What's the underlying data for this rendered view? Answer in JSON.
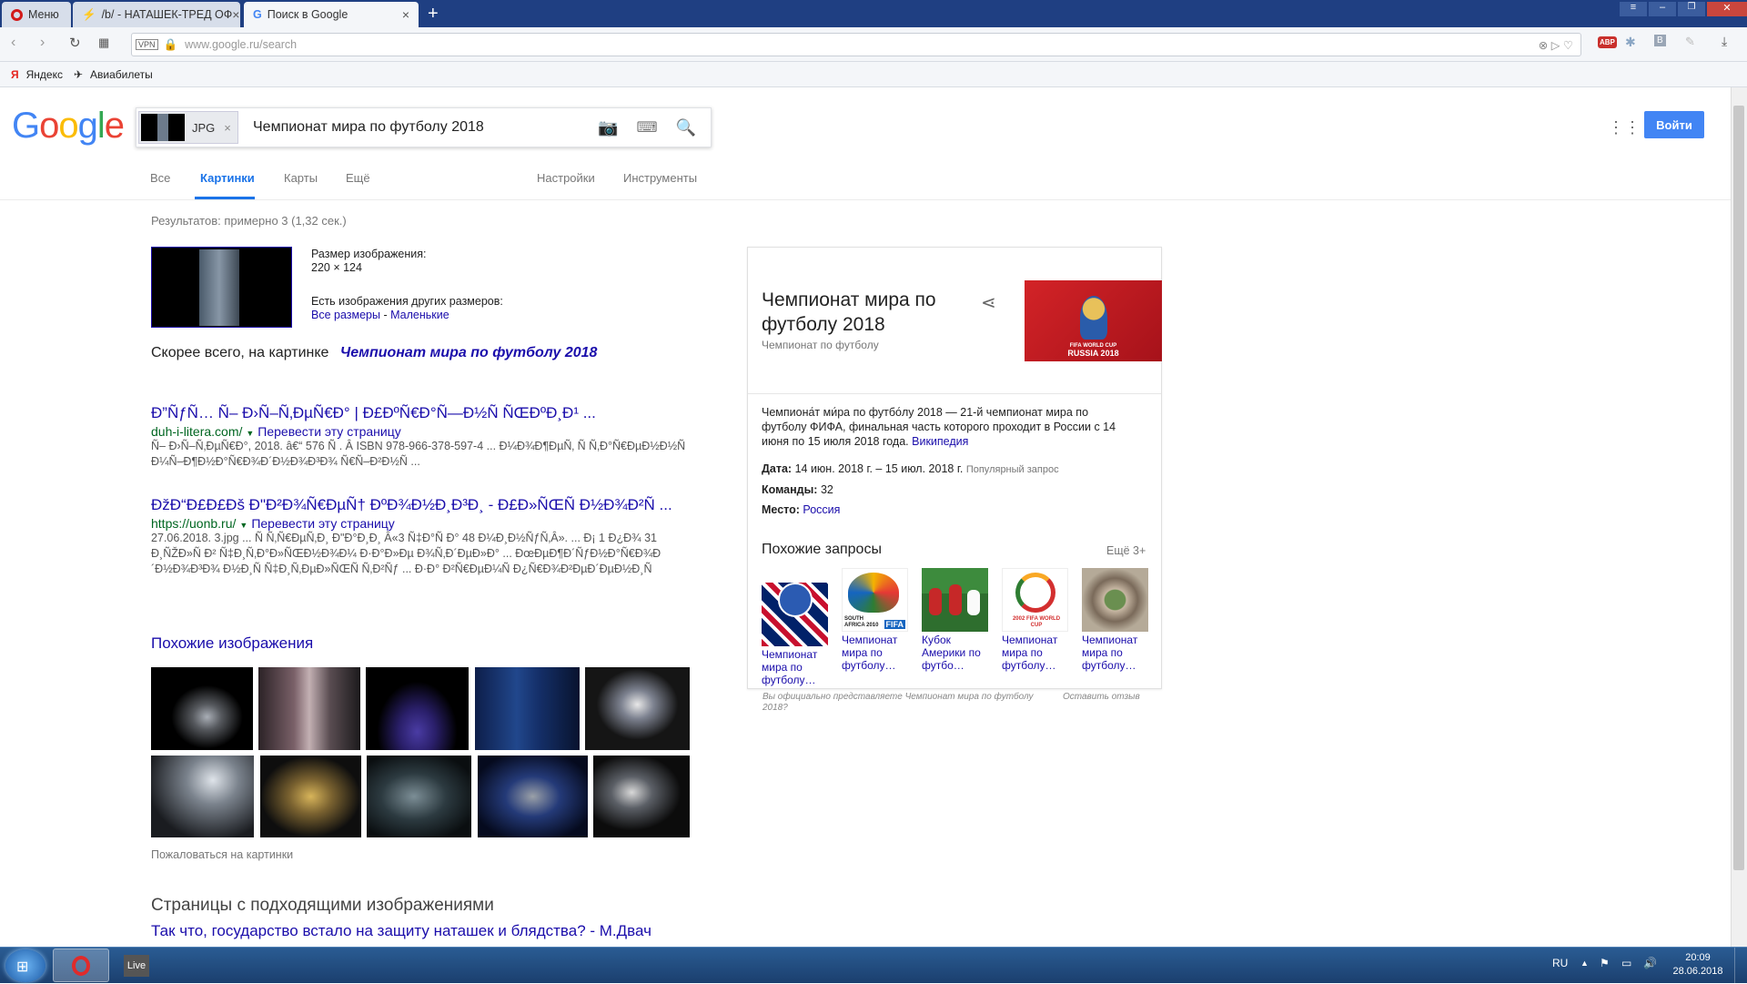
{
  "browser": {
    "tabs": [
      {
        "label": "Меню"
      },
      {
        "label": "/b/ - НАТАШЕК-ТРЕД ОФ"
      },
      {
        "label": "Поиск в Google"
      }
    ],
    "new_tab": "+",
    "address": {
      "host": "www.google.ru",
      "path": "/search"
    },
    "vpn": "VPN",
    "bookmarks": [
      {
        "label": "Яндекс"
      },
      {
        "label": "Авиабилеты"
      }
    ],
    "adblock_badge": "ABP"
  },
  "google": {
    "logo": "Google",
    "image_chip": "JPG",
    "query": "Чемпионат мира по футболу 2018",
    "signin": "Войти",
    "tabs": [
      {
        "label": "Все",
        "active": false
      },
      {
        "label": "Картинки",
        "active": true
      },
      {
        "label": "Карты",
        "active": false
      },
      {
        "label": "Ещё",
        "active": false
      }
    ],
    "tools": [
      {
        "label": "Настройки"
      },
      {
        "label": "Инструменты"
      }
    ]
  },
  "results": {
    "stats": "Результатов: примерно 3 (1,32 сек.)",
    "image_size_label": "Размер изображения:",
    "image_size": "220 × 124",
    "other_sizes_label": "Есть изображения других размеров:",
    "all_sizes": "Все размеры",
    "size_sep": " - ",
    "small": "Маленькие",
    "best_guess_prefix": "Скорее всего, на картинке",
    "best_guess": "Чемпионат мира по футболу 2018",
    "items": [
      {
        "title": "Ð”ÑƒÑ… Ñ– Ð›Ñ–Ñ‚ÐµÑ€Ð° | Ð£ÐºÑ€Ð°Ñ—Ð½Ñ ÑŒÐºÐ¸Ð¹ ...",
        "url": "duh-i-litera.com/",
        "translate": "Перевести эту страницу",
        "snippet": "Ñ– Ð›Ñ–Ñ‚ÐµÑ€Ð°, 2018. â€“ 576 Ñ . Â ISBN 978-966-378-597-4 ... Ð¼Ð¾Ð¶ÐµÑ‚ Ñ Ñ‚Ð°Ñ€ÐµÐ½Ð½Ñ Ð¼Ñ–Ð¶Ð½Ð°Ñ€Ð¾Ð´Ð½Ð¾Ð³Ð¾ Ñ€Ñ–Ð²Ð½Ñ ..."
      },
      {
        "title": "ÐžÐ“Ð£Ð£Ðš Ð\"Ð²Ð¾Ñ€ÐµÑ† ÐºÐ¾Ð½Ð¸Ð³Ð¸ - Ð£Ð»ÑŒÑ Ð½Ð¾Ð²Ñ ...",
        "url": "https://uonb.ru/",
        "translate": "Перевести эту страницу",
        "snippet": "27.06.2018. 3.jpg ... Ñ Ñ‚Ñ€ÐµÑ‚Ð¸ Ð\"Ð°Ð¸Ð¸ Â«3 Ñ‡Ð°Ñ Ð° 48 Ð¼Ð¸Ð½ÑƒÑ‚Â». ... Ð¡ 1 Ð¿Ð¾ 31 Ð¸ÑŽÐ»Ñ Ð² Ñ‡Ð¸Ñ‚Ð°Ð»ÑŒÐ½Ð¾Ð¼ Ð·Ð°Ð»Ðµ Ð¾Ñ‚Ð´ÐµÐ»Ð° ... ÐœÐµÐ¶Ð´ÑƒÐ½Ð°Ñ€Ð¾Ð´Ð½Ð¾Ð³Ð¾ Ð½Ð¸Ñ Ñ‡Ð¸Ñ‚ÐµÐ»ÑŒÑ Ñ‚Ð²Ñƒ ... Ð·Ð° Ð²Ñ€ÐµÐ¼Ñ Ð¿Ñ€Ð¾Ð²ÐµÐ´ÐµÐ½Ð¸Ñ Ñ‡ÐµÐ¼Ð¿Ð¸Ð¾Ð½Ð°Ñ‚Ð° ..."
      }
    ],
    "similar_title": "Похожие изображения",
    "report": "Пожаловаться на картинки",
    "pages_title": "Страницы с подходящими изображениями",
    "pages_first": "Так что, государство встало на защиту наташек и блядства? - М.Двач"
  },
  "knowledge": {
    "title": "Чемпионат мира по футболу 2018",
    "subtitle": "Чемпионат по футболу",
    "logo_text": "FIFA WORLD CUP",
    "logo_text2": "RUSSIA 2018",
    "description": "Чемпиона́т ми́ра по футбо́лу 2018 — 21-й чемпионат мира по футболу ФИФА, финальная часть которого проходит в России с 14 июня по 15 июля 2018 года.",
    "wiki": "Википедия",
    "facts": [
      {
        "label": "Дата:",
        "value": "14 июн. 2018 г. – 15 июл. 2018 г.",
        "extra": "Популярный запрос"
      },
      {
        "label": "Команды:",
        "value": "32",
        "extra": ""
      },
      {
        "label": "Место:",
        "value": "",
        "link": "Россия",
        "extra": ""
      }
    ],
    "related_title": "Похожие запросы",
    "related_more": "Ещё 3+",
    "related": [
      {
        "line1": "Чемпионат",
        "line2": "мира по",
        "line3": "футболу…"
      },
      {
        "line1": "Чемпионат",
        "line2": "мира по",
        "line3": "футболу…"
      },
      {
        "line1": "Кубок",
        "line2": "Америки по",
        "line3": "футбо…"
      },
      {
        "line1": "Чемпионат",
        "line2": "мира по",
        "line3": "футболу…"
      },
      {
        "line1": "Чемпионат",
        "line2": "мира по",
        "line3": "футболу…"
      }
    ],
    "related_thumb_labels": [
      "",
      "SOUTH AFRICA 2010",
      "",
      "2002 FIFA WORLD CUP",
      ""
    ],
    "claim": "Вы официально представляете Чемпионат мира по футболу 2018?",
    "feedback": "Оставить отзыв"
  },
  "taskbar": {
    "live": "Live",
    "lang": "RU",
    "time": "20:09",
    "date": "28.06.2018"
  },
  "colors": {
    "link": "#1a0dab",
    "green": "#006621",
    "signin": "#4285f4",
    "tabbar": "#1f3f82"
  }
}
